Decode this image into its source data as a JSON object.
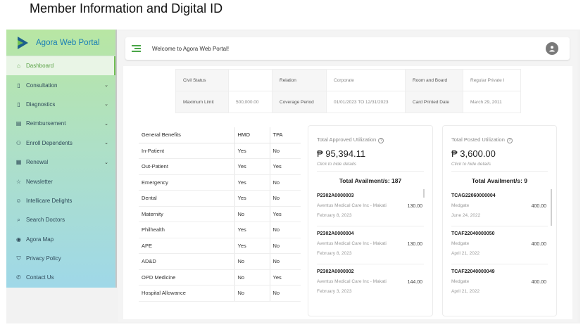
{
  "slide_title": "Member Information and Digital ID",
  "brand": "Agora Web Portal",
  "colors": {
    "accent_green": "#6fbf52",
    "brand_blue": "#1a7fb5"
  },
  "sidebar": {
    "items": [
      {
        "label": "Dashboard",
        "icon": "home-icon",
        "active": true
      },
      {
        "label": "Consultation",
        "icon": "document-icon",
        "chevron": true
      },
      {
        "label": "Diagnostics",
        "icon": "document-icon",
        "chevron": true
      },
      {
        "label": "Reimbursement",
        "icon": "receipt-icon",
        "chevron": true
      },
      {
        "label": "Enroll Dependents",
        "icon": "person-add-icon",
        "chevron": true
      },
      {
        "label": "Renewal",
        "icon": "calendar-icon",
        "chevron": true
      },
      {
        "label": "Newsletter",
        "icon": "star-icon"
      },
      {
        "label": "Intellicare Delights",
        "icon": "smile-icon"
      },
      {
        "label": "Search Doctors",
        "icon": "search-icon"
      },
      {
        "label": "Agora Map",
        "icon": "map-pin-icon"
      },
      {
        "label": "Privacy Policy",
        "icon": "shield-icon"
      },
      {
        "label": "Contact Us",
        "icon": "phone-icon"
      }
    ]
  },
  "header": {
    "welcome": "Welcome to Agora Web Portal!"
  },
  "member_info": {
    "row1": [
      "Civil Status",
      "",
      "Relation",
      "Corporate",
      "Room and Board",
      "Regular Private I"
    ],
    "row2": [
      "Maximum Limit",
      "500,000.00",
      "Coverage Period",
      "01/01/2023 TO 12/31/2023",
      "Card Printed Date",
      "March 29, 2011"
    ]
  },
  "benefits": {
    "headers": [
      "General Benefits",
      "HMO",
      "TPA"
    ],
    "rows": [
      [
        "In-Patient",
        "Yes",
        "No"
      ],
      [
        "Out-Patient",
        "Yes",
        "Yes"
      ],
      [
        "Emergency",
        "Yes",
        "No"
      ],
      [
        "Dental",
        "Yes",
        "No"
      ],
      [
        "Maternity",
        "No",
        "Yes"
      ],
      [
        "Philhealth",
        "Yes",
        "No"
      ],
      [
        "APE",
        "Yes",
        "No"
      ],
      [
        "AD&D",
        "No",
        "No"
      ],
      [
        "OPD Medicine",
        "No",
        "Yes"
      ],
      [
        "Hospital Allowance",
        "No",
        "No"
      ]
    ]
  },
  "approved": {
    "title": "Total Approved Utilization",
    "amount": "₱ 95,394.11",
    "hide": "Click to hide details",
    "availments": "Total Availment/s: 187",
    "entries": [
      {
        "code": "P2302A0000003",
        "provider": "Aventus Medical Care Inc - Makati",
        "date": "February 8, 2023",
        "amount": "130.00"
      },
      {
        "code": "P2302A0000004",
        "provider": "Aventus Medical Care Inc - Makati",
        "date": "February 8, 2023",
        "amount": "130.00"
      },
      {
        "code": "P2302A0000002",
        "provider": "Aventus Medical Care Inc - Makati",
        "date": "February 3, 2023",
        "amount": "144.00"
      }
    ]
  },
  "posted": {
    "title": "Total Posted Utilization",
    "amount": "₱ 3,600.00",
    "hide": "Click to hide details",
    "availments": "Total Availment/s: 9",
    "entries": [
      {
        "code": "TCAG22060000004",
        "provider": "Medgate",
        "date": "June 24, 2022",
        "amount": "400.00"
      },
      {
        "code": "TCAF22040000050",
        "provider": "Medgate",
        "date": "April 21, 2022",
        "amount": "400.00"
      },
      {
        "code": "TCAF22040000049",
        "provider": "Medgate",
        "date": "April 21, 2022",
        "amount": "400.00"
      }
    ]
  }
}
